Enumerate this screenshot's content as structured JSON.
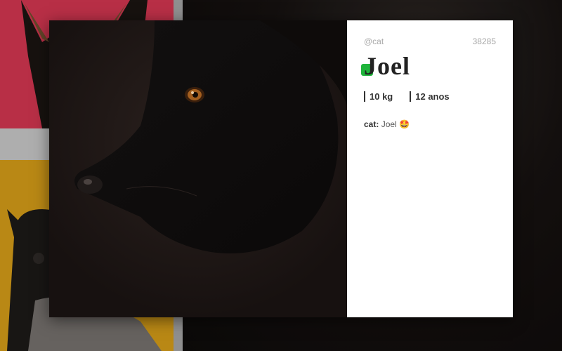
{
  "pet": {
    "username": "@cat",
    "votes": "38285",
    "name": "Joel",
    "weight": "10 kg",
    "age": "12 anos"
  },
  "comments": [
    {
      "author": "cat:",
      "text": "Joel 🤩"
    }
  ],
  "colors": {
    "accent": "#1fb53b",
    "background_red": "#c8344c",
    "background_yellow": "#c99417",
    "modal_bg": "#ffffff"
  },
  "icons": {
    "name_accent": "green-square-icon"
  }
}
